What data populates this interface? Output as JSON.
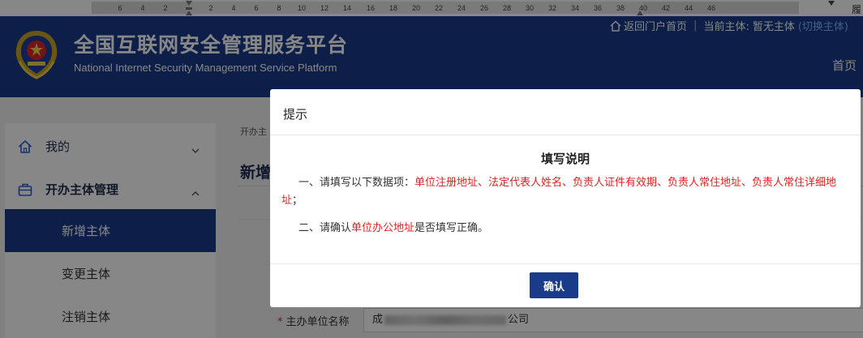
{
  "ruler": {
    "numbers": [
      "6",
      "4",
      "2",
      "2",
      "4",
      "6",
      "8",
      "10",
      "12",
      "14",
      "16",
      "18",
      "20",
      "22",
      "24",
      "26",
      "28",
      "30",
      "32",
      "34",
      "36",
      "38",
      "40",
      "42",
      "44",
      "46"
    ],
    "right_char": "履"
  },
  "header": {
    "title_cn": "全国互联网安全管理服务平台",
    "title_en": "National Internet Security Management Service Platform",
    "back_link": "返回门户首页",
    "current_subject_label": "当前主体:",
    "current_subject_value": "暂无主体",
    "switch_link": "(切换主体)",
    "nav_home": "首页",
    "bg_color": "#1a3a8a"
  },
  "sidebar": {
    "items": [
      {
        "label": "我的",
        "icon": "home-icon"
      },
      {
        "label": "开办主体管理",
        "icon": "briefcase-icon"
      }
    ],
    "subitems": [
      {
        "label": "新增主体",
        "active": true
      },
      {
        "label": "变更主体",
        "active": false
      },
      {
        "label": "注销主体",
        "active": false
      }
    ]
  },
  "main": {
    "breadcrumb": "开办主",
    "page_title": "新增",
    "field_label": "主办单位名称",
    "field_value_start": "成",
    "field_value_end": "公司"
  },
  "modal": {
    "title": "提示",
    "instructions_title": "填写说明",
    "line1_prefix": "一、请填写以下数据项：",
    "line1_highlight": "单位注册地址、法定代表人姓名、负责人证件有效期、负责人常住地址、负责人常住详细地址",
    "line1_suffix": "；",
    "line2_prefix": "二、请确认",
    "line2_highlight": "单位办公地址",
    "line2_suffix": "是否填写正确。",
    "confirm_label": "确认",
    "highlight_color": "#e02020"
  }
}
